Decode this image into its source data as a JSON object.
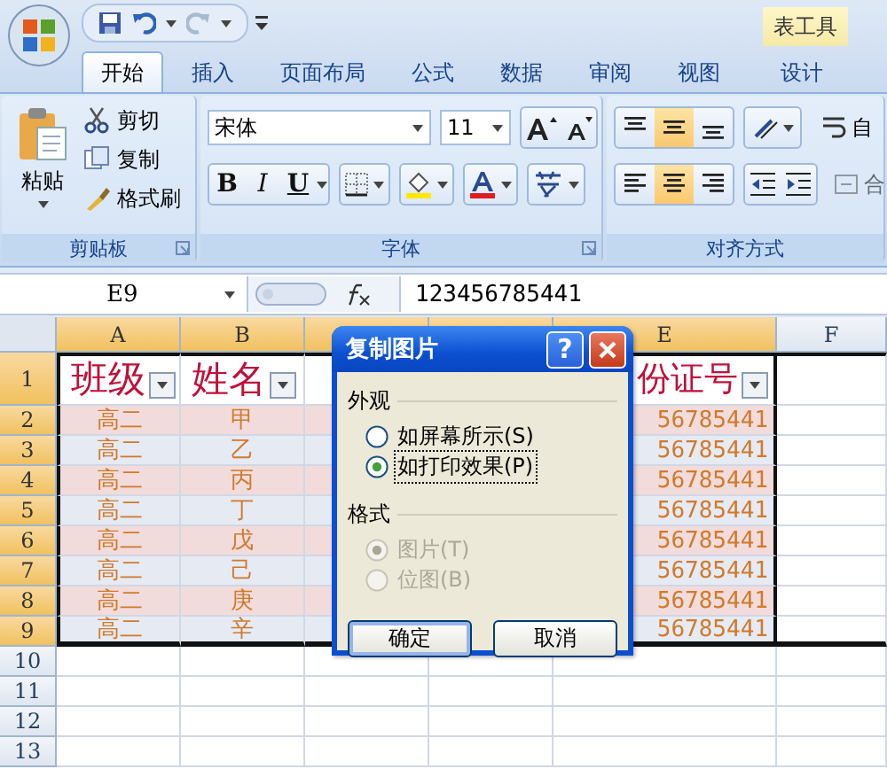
{
  "contextual_tab_group": "表工具",
  "tabs": [
    {
      "label": "开始",
      "selected": true
    },
    {
      "label": "插入",
      "selected": false
    },
    {
      "label": "页面布局",
      "selected": false
    },
    {
      "label": "公式",
      "selected": false
    },
    {
      "label": "数据",
      "selected": false
    },
    {
      "label": "审阅",
      "selected": false
    },
    {
      "label": "视图",
      "selected": false
    },
    {
      "label": "设计",
      "selected": false
    }
  ],
  "clipboard": {
    "label": "剪贴板",
    "paste": "粘贴",
    "actions": [
      {
        "kind": "cut",
        "label": "剪切"
      },
      {
        "kind": "copy",
        "label": "复制"
      },
      {
        "kind": "painter",
        "label": "格式刷"
      }
    ]
  },
  "font": {
    "label": "字体",
    "font_name": "宋体",
    "font_size": "11",
    "styles": [
      {
        "kind": "bold",
        "label": "B"
      },
      {
        "kind": "italic",
        "label": "I"
      },
      {
        "kind": "underline",
        "label": "U"
      }
    ]
  },
  "alignment": {
    "label": "对齐方式",
    "vertical": [
      {
        "kind": "top",
        "selected": false
      },
      {
        "kind": "middle",
        "selected": true
      },
      {
        "kind": "bottom",
        "selected": false
      }
    ],
    "horizontal": [
      {
        "kind": "left",
        "selected": false
      },
      {
        "kind": "center",
        "selected": true
      },
      {
        "kind": "right",
        "selected": false
      }
    ],
    "wrap_text": "自",
    "merge": "合"
  },
  "formula_bar": {
    "name_box": "E9",
    "value": "123456785441"
  },
  "sheet": {
    "columns": [
      {
        "label": "A",
        "selected": true
      },
      {
        "label": "B",
        "selected": true
      },
      {
        "selected": true
      },
      {
        "selected": true
      },
      {
        "label": "E",
        "selected": true
      },
      {
        "label": "F",
        "selected": false
      }
    ],
    "rows": [
      {
        "kind": "header",
        "number": "1",
        "selected": true,
        "class": "班级",
        "name": "姓名",
        "id": "份证号"
      },
      {
        "kind": "data",
        "number": "2",
        "selected": true,
        "class": "高二",
        "name": "甲",
        "id": "56785441"
      },
      {
        "kind": "data",
        "number": "3",
        "selected": true,
        "class": "高二",
        "name": "乙",
        "id": "56785441"
      },
      {
        "kind": "data",
        "number": "4",
        "selected": true,
        "class": "高二",
        "name": "丙",
        "id": "56785441"
      },
      {
        "kind": "data",
        "number": "5",
        "selected": true,
        "class": "高二",
        "name": "丁",
        "id": "56785441"
      },
      {
        "kind": "data",
        "number": "6",
        "selected": true,
        "class": "高二",
        "name": "戊",
        "id": "56785441"
      },
      {
        "kind": "data",
        "number": "7",
        "selected": true,
        "class": "高二",
        "name": "己",
        "id": "56785441"
      },
      {
        "kind": "data",
        "number": "8",
        "selected": true,
        "class": "高二",
        "name": "庚",
        "id": "56785441"
      },
      {
        "kind": "data",
        "number": "9",
        "selected": true,
        "class": "高二",
        "name": "辛",
        "id": "56785441"
      },
      {
        "kind": "empty",
        "number": "10",
        "selected": false
      },
      {
        "kind": "empty",
        "number": "11",
        "selected": false
      },
      {
        "kind": "empty",
        "number": "12",
        "selected": false
      },
      {
        "kind": "empty",
        "number": "13",
        "selected": false
      }
    ]
  },
  "dialog": {
    "title": "复制图片",
    "help_button": "?",
    "groups": [
      {
        "label": "外观",
        "disabled": false,
        "options": [
          {
            "label": "如屏幕所示(S)",
            "selected": false,
            "focused": false
          },
          {
            "label": "如打印效果(P)",
            "selected": true,
            "focused": true
          }
        ]
      },
      {
        "label": "格式",
        "disabled": true,
        "options": [
          {
            "label": "图片(T)",
            "selected": true,
            "focused": false
          },
          {
            "label": "位图(B)",
            "selected": false,
            "focused": false
          }
        ]
      }
    ],
    "buttons": [
      {
        "label": "确定",
        "default": true
      },
      {
        "label": "取消",
        "default": false
      }
    ]
  }
}
